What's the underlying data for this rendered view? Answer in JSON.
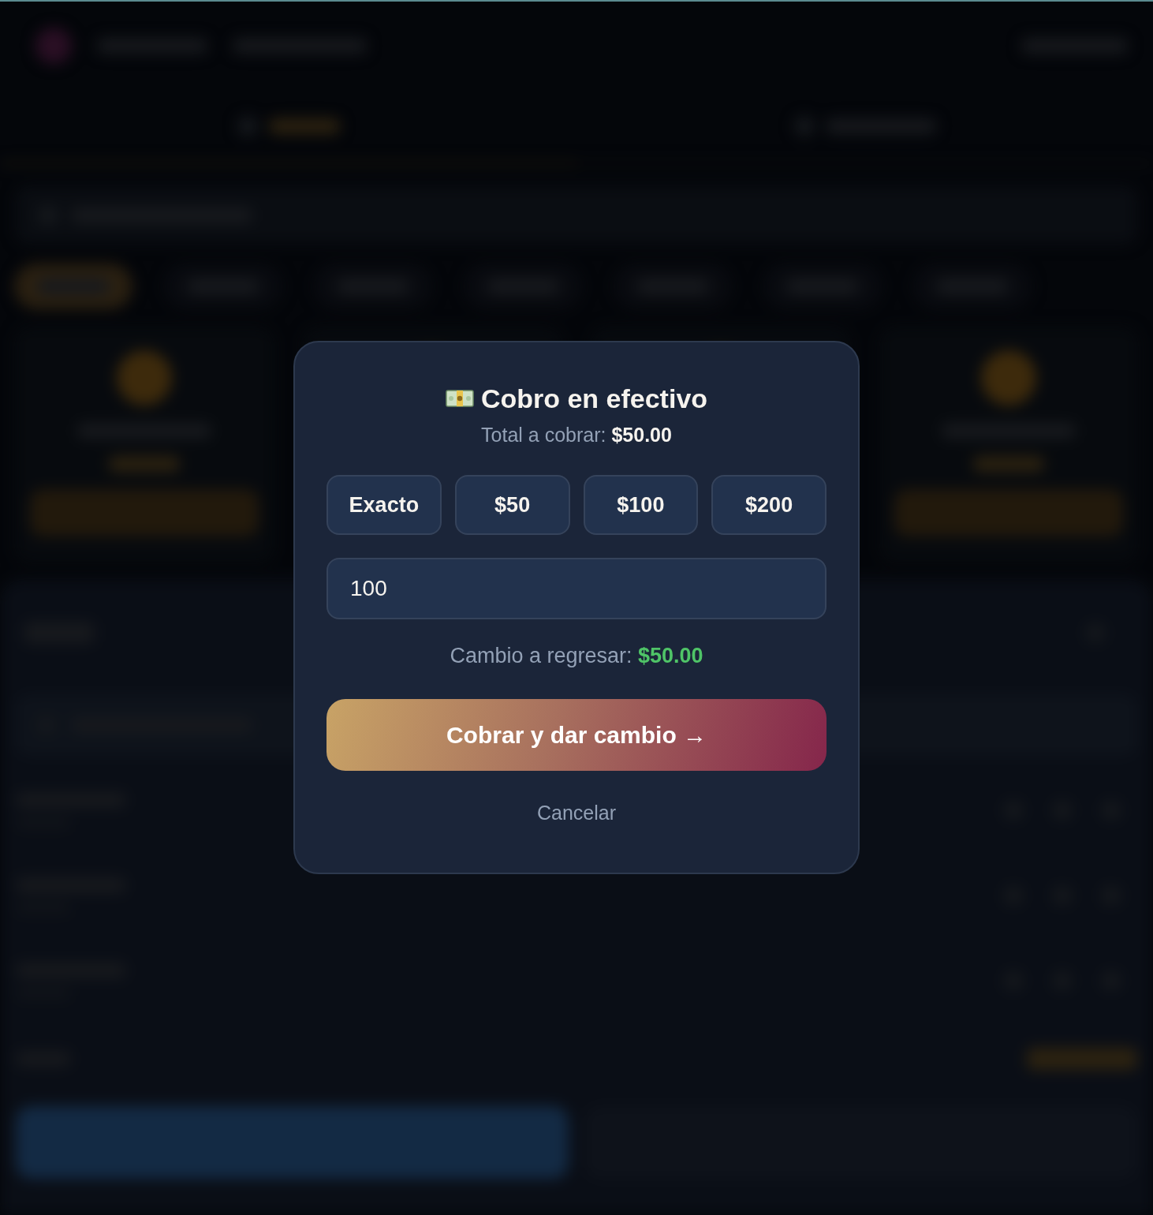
{
  "dialog": {
    "title": "Cobro en efectivo",
    "total": "Total a cobrar: **$50.00**",
    "quick_amounts": [
      {
        "label": "Exacto"
      },
      {
        "label": "$50"
      },
      {
        "label": "$100"
      },
      {
        "label": "$200"
      }
    ],
    "amount_field": {
      "value": "100"
    },
    "change": "Cambio a regresar: **$50.00**",
    "confirm_button": "Cobrar y dar cambio →",
    "cancel_button": "Cancelar"
  }
}
